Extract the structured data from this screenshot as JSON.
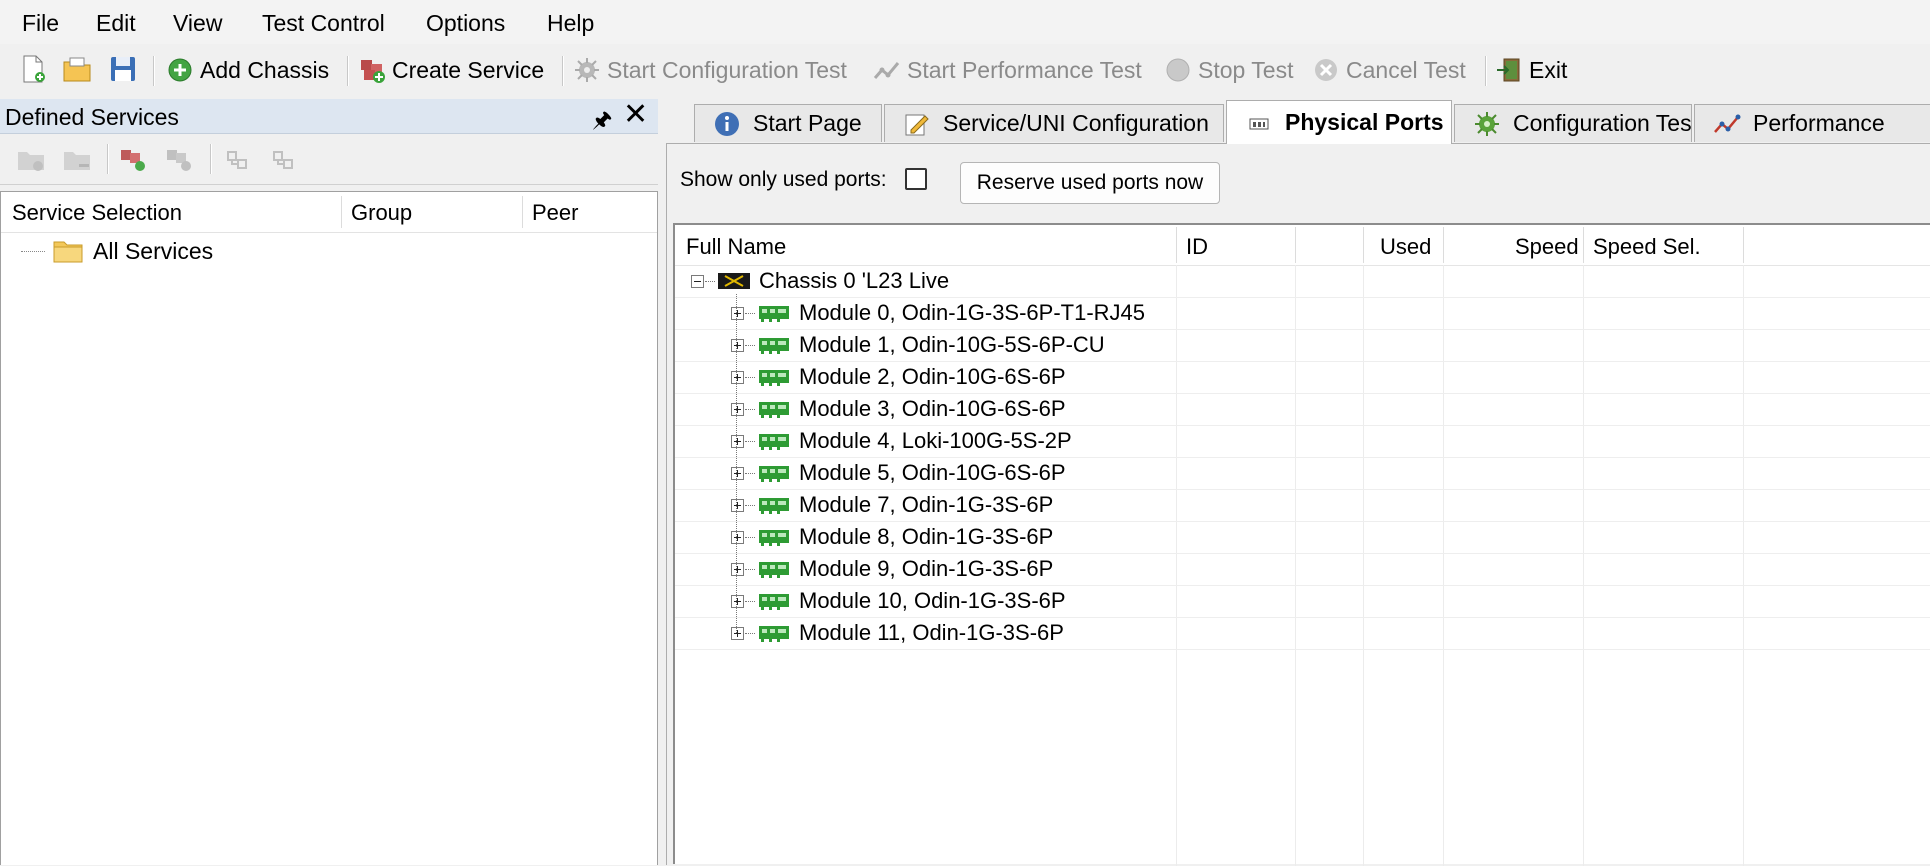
{
  "menu": [
    "File",
    "Edit",
    "View",
    "Test Control",
    "Options",
    "Help"
  ],
  "toolbar": {
    "add_chassis": "Add Chassis",
    "create_service": "Create Service",
    "start_config_test": "Start Configuration Test",
    "start_perf_test": "Start Performance Test",
    "stop_test": "Stop Test",
    "cancel_test": "Cancel Test",
    "exit": "Exit"
  },
  "left_panel": {
    "title": "Defined Services",
    "columns": [
      "Service Selection",
      "Group",
      "Peer"
    ],
    "tree_root": "All Services"
  },
  "tabs": [
    "Start Page",
    "Service/UNI Configuration",
    "Physical Ports",
    "Configuration Test",
    "Performance"
  ],
  "active_tab": "Physical Ports",
  "ports_panel": {
    "show_only_used_label": "Show only used ports:",
    "show_only_used_checked": false,
    "reserve_button": "Reserve used ports now"
  },
  "grid": {
    "columns": [
      "Full Name",
      "ID",
      "",
      "Used",
      "Speed",
      "Speed Sel."
    ],
    "chassis": "Chassis 0 'L23 Live",
    "modules": [
      "Module 0, Odin-1G-3S-6P-T1-RJ45",
      "Module 1, Odin-10G-5S-6P-CU",
      "Module 2, Odin-10G-6S-6P",
      "Module 3, Odin-10G-6S-6P",
      "Module 4, Loki-100G-5S-2P",
      "Module 5, Odin-10G-6S-6P",
      "Module 7, Odin-1G-3S-6P",
      "Module 8, Odin-1G-3S-6P",
      "Module 9, Odin-1G-3S-6P",
      "Module 10, Odin-1G-3S-6P",
      "Module 11, Odin-1G-3S-6P"
    ]
  },
  "colors": {
    "panel_title_bg": "#dde6f1",
    "module_icon": "#2e9b34",
    "window_bg": "#f0f0f0"
  }
}
